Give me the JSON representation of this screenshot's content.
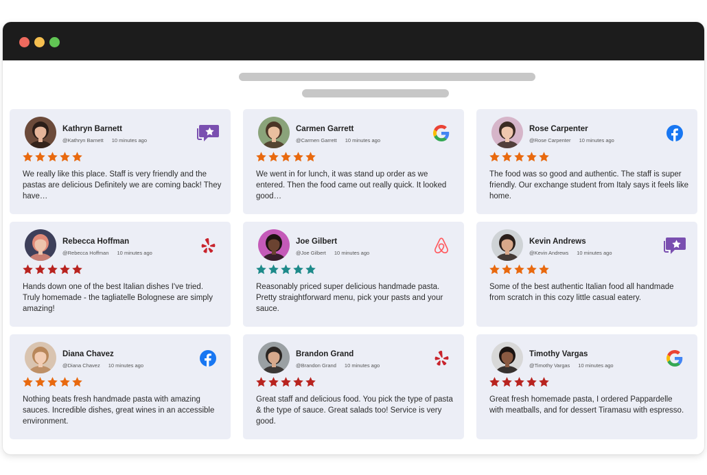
{
  "window": {
    "controls": [
      "close",
      "minimize",
      "maximize"
    ]
  },
  "colors": {
    "star_orange": "#e8690f",
    "star_red": "#b8231f",
    "star_teal": "#1e8a8a",
    "card_bg": "#eceef6"
  },
  "reviews": [
    {
      "name": "Kathryn Barnett",
      "handle": "@Kathryn Barnett",
      "time": "10 minutes ago",
      "source": "testimonial-icon",
      "star_color": "#e8690f",
      "rating": 5,
      "text": "We really like this place.  Staff is very friendly and the pastas are delicious Definitely we are coming back!  They have…",
      "avatar": {
        "bg": "#6b4a3a",
        "hair": "#2a1d18",
        "skin": "#e6b59a"
      }
    },
    {
      "name": "Carmen Garrett",
      "handle": "@Carmen Garrett",
      "time": "10 minutes ago",
      "source": "google-icon",
      "star_color": "#e8690f",
      "rating": 5,
      "text": "We went in for lunch, it was stand up order as we entered. Then the food came out really quick. It looked good…",
      "avatar": {
        "bg": "#8aa37a",
        "hair": "#4a3526",
        "skin": "#e9bf9f"
      }
    },
    {
      "name": "Rose Carpenter",
      "handle": "@Rose Carpenter",
      "time": "10 minutes ago",
      "source": "facebook-icon",
      "star_color": "#e8690f",
      "rating": 5,
      "text": "The food was so good and authentic. The staff is super friendly. Our exchange student from Italy says it feels like home.",
      "avatar": {
        "bg": "#d6b5c9",
        "hair": "#3b2a22",
        "skin": "#f0c7ae"
      }
    },
    {
      "name": "Rebecca Hoffman",
      "handle": "@Rebecca Hoffman",
      "time": "10 minutes ago",
      "source": "yelp-icon",
      "star_color": "#b8231f",
      "rating": 5,
      "text": "Hands down one of the best Italian dishes I've tried. Truly homemade - the tagliatelle Bolognese are simply amazing!",
      "avatar": {
        "bg": "#3d3f5a",
        "hair": "#e08a78",
        "skin": "#edc4ac"
      }
    },
    {
      "name": "Joe Gilbert",
      "handle": "@Joe Gilbert",
      "time": "10 minutes ago",
      "source": "airbnb-icon",
      "star_color": "#1e8a8a",
      "rating": 5,
      "text": "Reasonably priced super delicious handmade pasta. Pretty straightforward menu, pick your pasts and your sauce.",
      "avatar": {
        "bg": "#c45ab8",
        "hair": "#1e1412",
        "skin": "#6b4331"
      }
    },
    {
      "name": "Kevin Andrews",
      "handle": "@Kevin Andrews",
      "time": "10 minutes ago",
      "source": "testimonial-icon",
      "star_color": "#e8690f",
      "rating": 5,
      "text": "Some of the best authentic Italian food all handmade from scratch in this cozy little casual eatery.",
      "avatar": {
        "bg": "#cfd3d6",
        "hair": "#2b1f1a",
        "skin": "#d9a88a"
      }
    },
    {
      "name": "Diana Chavez",
      "handle": "@Diana Chavez",
      "time": "10 minutes ago",
      "source": "facebook-icon",
      "star_color": "#e8690f",
      "rating": 5,
      "text": "Nothing beats fresh handmade pasta with amazing sauces. Incredible dishes, great wines in an accessible environment.",
      "avatar": {
        "bg": "#d9c4b0",
        "hair": "#b8875a",
        "skin": "#f2cdb4"
      }
    },
    {
      "name": "Brandon Grand",
      "handle": "@Brandon Grand",
      "time": "10 minutes ago",
      "source": "yelp-icon",
      "star_color": "#b8231f",
      "rating": 5,
      "text": "Great staff and delicious food. You pick the type of pasta & the type of sauce. Great salads too! Service is very good.",
      "avatar": {
        "bg": "#9aa0a3",
        "hair": "#2a2522",
        "skin": "#d6a98c"
      }
    },
    {
      "name": "Timothy Vargas",
      "handle": "@Timothy Vargas",
      "time": "10 minutes ago",
      "source": "google-icon",
      "star_color": "#b8231f",
      "rating": 5,
      "text": "Great fresh homemade pasta, I ordered Pappardelle with meatballs, and for dessert Tiramasu with espresso.",
      "avatar": {
        "bg": "#d8d8d8",
        "hair": "#1b1412",
        "skin": "#8a5a42"
      }
    }
  ]
}
